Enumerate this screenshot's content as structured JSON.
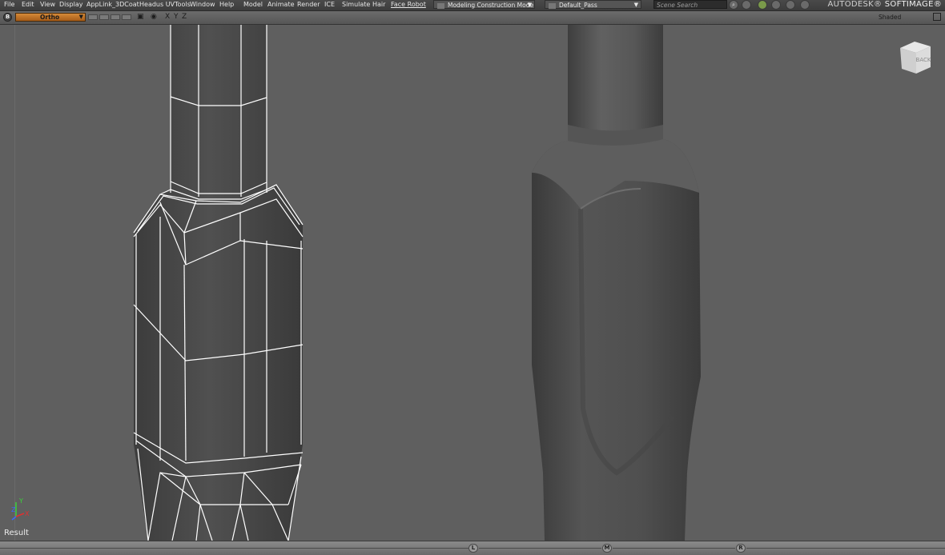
{
  "menubar": {
    "items": [
      "File",
      "Edit",
      "View",
      "Display",
      "AppLink_3DCoat",
      "Headus UVTools",
      "Window",
      "Help",
      "Model",
      "Animate",
      "Render",
      "ICE",
      "Simulate",
      "Hair",
      "Face Robot"
    ],
    "mode_dropdown": "Modeling Construction Mode",
    "pass_dropdown": "Default_Pass",
    "search_placeholder": "Scene Search",
    "brand_prefix": "AUTODESK®",
    "brand_name": "SOFTIMAGE®"
  },
  "viewport_bar": {
    "badge": "B",
    "camera": "Ortho",
    "axes": [
      "X",
      "Y",
      "Z"
    ],
    "display_mode": "Shaded"
  },
  "viewport": {
    "navcube_face": "BACK",
    "status_label": "Result",
    "axis_labels": [
      "Z",
      "Y",
      "X"
    ]
  },
  "timeline": {
    "buttons": [
      "L",
      "M",
      "R"
    ]
  },
  "colors": {
    "viewport_bg": "#5f5f5f",
    "camera_orange": "#c97a2c",
    "wire": "#ffffff"
  }
}
